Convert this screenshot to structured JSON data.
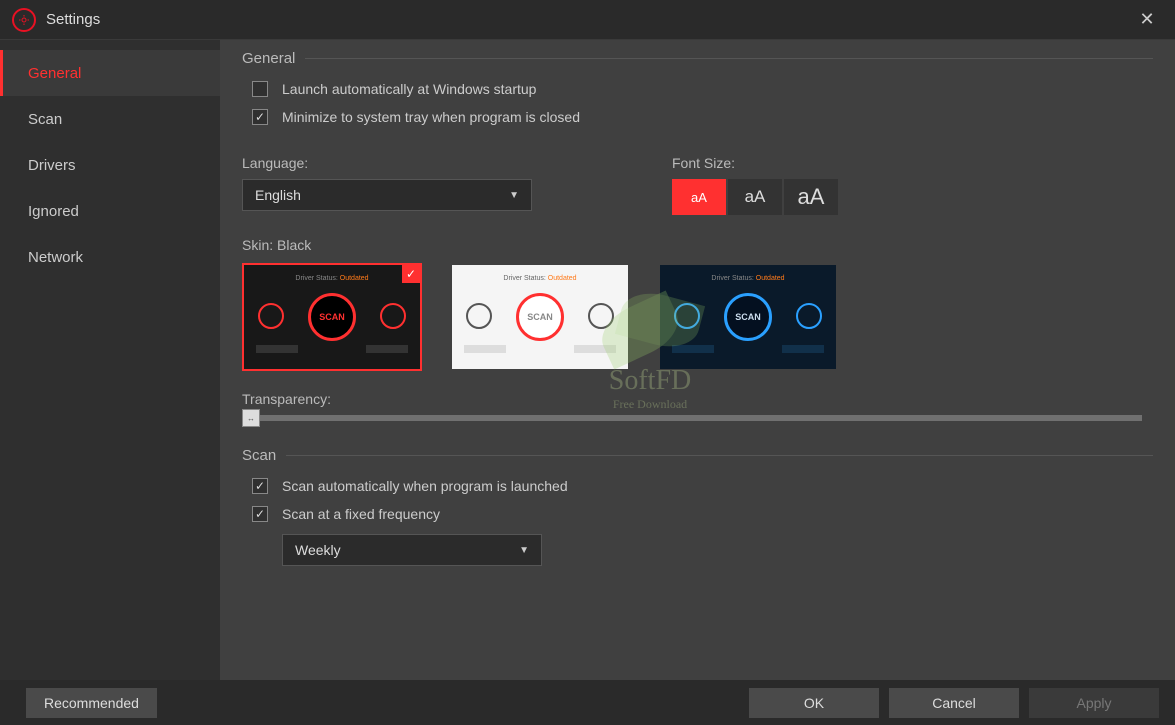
{
  "window": {
    "title": "Settings"
  },
  "sidebar": {
    "items": [
      {
        "label": "General"
      },
      {
        "label": "Scan"
      },
      {
        "label": "Drivers"
      },
      {
        "label": "Ignored"
      },
      {
        "label": "Network"
      }
    ]
  },
  "general": {
    "heading": "General",
    "launch_label": "Launch automatically at Windows startup",
    "minimize_label": "Minimize to system tray when program is closed",
    "language_label": "Language:",
    "language_value": "English",
    "font_size_label": "Font Size:",
    "font_small": "aA",
    "font_medium": "aA",
    "font_large": "aA",
    "skin_label": "Skin: Black",
    "scan_text": "SCAN",
    "thumb_status_prefix": "Driver Status:",
    "transparency_label": "Transparency:",
    "slider_handle_glyph": "↔"
  },
  "scan": {
    "heading": "Scan",
    "auto_label": "Scan automatically when program is launched",
    "freq_label": "Scan at a fixed frequency",
    "freq_value": "Weekly"
  },
  "footer": {
    "recommended": "Recommended",
    "ok": "OK",
    "cancel": "Cancel",
    "apply": "Apply"
  },
  "watermark": {
    "text": "SoftFD",
    "sub": "Free Download"
  }
}
